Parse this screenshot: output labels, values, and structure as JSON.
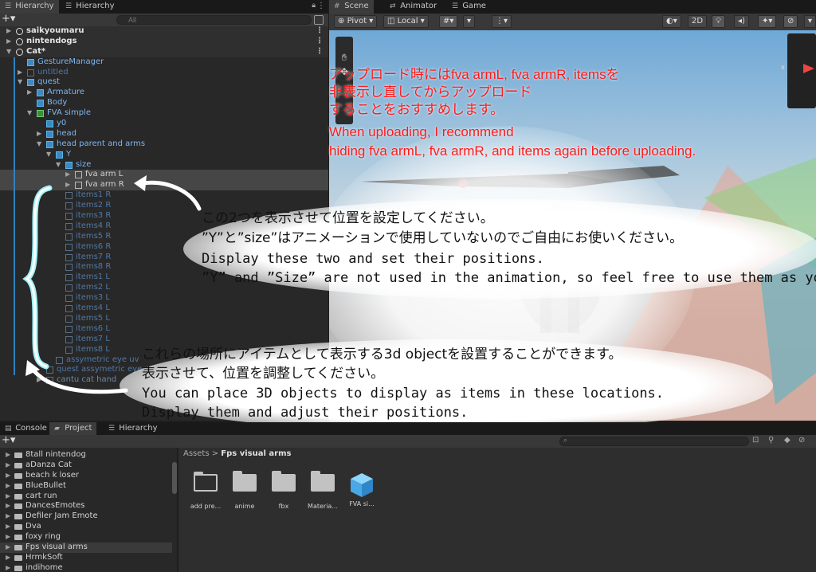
{
  "hierarchy": {
    "tabs": [
      "Hierarchy",
      "Hierarchy"
    ],
    "search_placeholder": "All",
    "rows": [
      {
        "label": "saikyoumaru",
        "depth": 0,
        "kind": "scene",
        "arrow": "▶"
      },
      {
        "label": "nintendogs",
        "depth": 0,
        "kind": "scene",
        "arrow": "▶"
      },
      {
        "label": "Cat*",
        "depth": 0,
        "kind": "scene",
        "arrow": "▼"
      },
      {
        "label": "GestureManager",
        "depth": 1,
        "kind": "blue",
        "arrow": ""
      },
      {
        "label": "untitled",
        "depth": 1,
        "kind": "dim",
        "arrow": "▶"
      },
      {
        "label": "quest",
        "depth": 1,
        "kind": "blue",
        "arrow": "▼"
      },
      {
        "label": "Armature",
        "depth": 2,
        "kind": "blue",
        "arrow": "▶"
      },
      {
        "label": "Body",
        "depth": 2,
        "kind": "blue",
        "arrow": ""
      },
      {
        "label": "FVA simple",
        "depth": 2,
        "kind": "green",
        "arrow": "▼"
      },
      {
        "label": "y0",
        "depth": 3,
        "kind": "blue",
        "arrow": ""
      },
      {
        "label": "head",
        "depth": 3,
        "kind": "blue",
        "arrow": "▶"
      },
      {
        "label": "head parent and arms",
        "depth": 3,
        "kind": "blue",
        "arrow": "▼"
      },
      {
        "label": "Y",
        "depth": 4,
        "kind": "blue",
        "arrow": "▼"
      },
      {
        "label": "size",
        "depth": 5,
        "kind": "blue",
        "arrow": "▼"
      },
      {
        "label": "fva arm L",
        "depth": 6,
        "kind": "sel",
        "arrow": "▶"
      },
      {
        "label": "fva arm R",
        "depth": 6,
        "kind": "sel",
        "arrow": "▶"
      },
      {
        "label": "items1 R",
        "depth": 5,
        "kind": "dim",
        "arrow": ""
      },
      {
        "label": "items2 R",
        "depth": 5,
        "kind": "dim",
        "arrow": ""
      },
      {
        "label": "items3 R",
        "depth": 5,
        "kind": "dim",
        "arrow": ""
      },
      {
        "label": "items4 R",
        "depth": 5,
        "kind": "dim",
        "arrow": ""
      },
      {
        "label": "items5 R",
        "depth": 5,
        "kind": "dim",
        "arrow": ""
      },
      {
        "label": "items6 R",
        "depth": 5,
        "kind": "dim",
        "arrow": ""
      },
      {
        "label": "items7 R",
        "depth": 5,
        "kind": "dim",
        "arrow": ""
      },
      {
        "label": "items8 R",
        "depth": 5,
        "kind": "dim",
        "arrow": ""
      },
      {
        "label": "items1 L",
        "depth": 5,
        "kind": "dim",
        "arrow": ""
      },
      {
        "label": "items2 L",
        "depth": 5,
        "kind": "dim",
        "arrow": ""
      },
      {
        "label": "items3 L",
        "depth": 5,
        "kind": "dim",
        "arrow": ""
      },
      {
        "label": "items4 L",
        "depth": 5,
        "kind": "dim",
        "arrow": ""
      },
      {
        "label": "items5 L",
        "depth": 5,
        "kind": "dim",
        "arrow": ""
      },
      {
        "label": "items6 L",
        "depth": 5,
        "kind": "dim",
        "arrow": ""
      },
      {
        "label": "items7 L",
        "depth": 5,
        "kind": "dim",
        "arrow": ""
      },
      {
        "label": "items8 L",
        "depth": 5,
        "kind": "dim",
        "arrow": ""
      },
      {
        "label": "assymetric eye uv",
        "depth": 4,
        "kind": "dim",
        "arrow": ""
      },
      {
        "label": "quest assymetric eye uv",
        "depth": 3,
        "kind": "dim",
        "arrow": ""
      },
      {
        "label": "cantu cat hand",
        "depth": 3,
        "kind": "grey",
        "arrow": "▶"
      }
    ]
  },
  "scene": {
    "tabs": [
      "Scene",
      "Animator",
      "Game"
    ],
    "toolbar": {
      "pivot": "Pivot",
      "local": "Local",
      "mode_2d": "2D"
    },
    "gizmo_axis": "x"
  },
  "annotations": {
    "red_jp_lines": [
      "アップロード時にはfva armL, fva armR, itemsを",
      "非表示し直してからアップロード",
      "することをおすすめします。"
    ],
    "red_en_lines": [
      "When uploading, I recommend",
      "hiding fva armL, fva armR, and items again before uploading."
    ],
    "note1_lines": [
      "この2つを表示させて位置を設定してください。",
      "”Y”と”size”はアニメーションで使用していないのでご自由にお使いください。",
      "Display these two and set their positions.",
      "”Y” and ”Size” are not used in the animation, so feel free to use them as yo"
    ],
    "note2_lines": [
      "これらの場所にアイテムとして表示する3d objectを設置することができます。",
      "表示させて、位置を調整してください。",
      "You can place 3D objects to display as items in these locations.",
      "Display them and adjust their positions."
    ]
  },
  "bottom": {
    "tabs": [
      "Console",
      "Project",
      "Hierarchy"
    ],
    "folders": [
      "8tall nintendog",
      "aDanza Cat",
      "beach k loser",
      "BlueBullet",
      "cart run",
      "DancesEmotes",
      "Defiler Jam Emote",
      "Dva",
      "foxy ring",
      "Fps visual arms",
      "HrmkSoft",
      "indihome"
    ],
    "selected_folder": "Fps visual arms",
    "breadcrumb": {
      "root": "Assets",
      "current": "Fps visual arms"
    },
    "assets": [
      "add pre...",
      "anime",
      "fbx",
      "Materia...",
      "FVA si..."
    ]
  },
  "colors": {
    "annotation_red": "#ff1a1a",
    "selection_blue": "#2f82c2",
    "arrow_cyan": "#6fe4f0"
  }
}
